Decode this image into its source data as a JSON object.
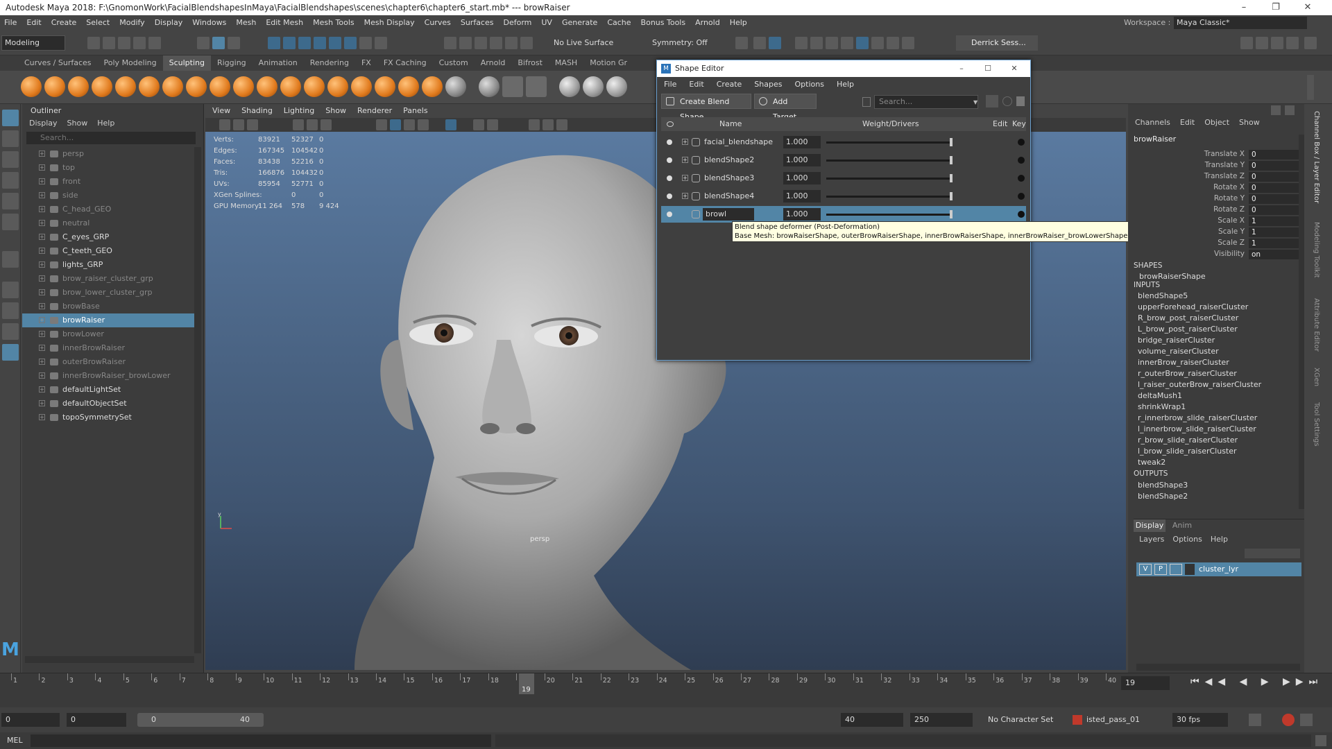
{
  "window": {
    "title": "Autodesk Maya 2018: F:\\GnomonWork\\FacialBlendshapesInMaya\\FacialBlendshapes\\scenes\\chapter6\\chapter6_start.mb*  ---  browRaiser"
  },
  "menubar": [
    "File",
    "Edit",
    "Create",
    "Select",
    "Modify",
    "Display",
    "Windows",
    "Mesh",
    "Edit Mesh",
    "Mesh Tools",
    "Mesh Display",
    "Curves",
    "Surfaces",
    "Deform",
    "UV",
    "Generate",
    "Cache",
    "Bonus Tools",
    "Arnold",
    "Help"
  ],
  "workspace": {
    "label": "Workspace :",
    "value": "Maya Classic*"
  },
  "statusline": {
    "menuset": "Modeling",
    "live_surface": "No Live Surface",
    "symmetry": "Symmetry: Off",
    "user": "Derrick Sess..."
  },
  "shelf_tabs": [
    "Curves / Surfaces",
    "Poly Modeling",
    "Sculpting",
    "Rigging",
    "Animation",
    "Rendering",
    "FX",
    "FX Caching",
    "Custom",
    "Arnold",
    "Bifrost",
    "MASH",
    "Motion Gr"
  ],
  "shelf_active": "Sculpting",
  "outliner": {
    "title": "Outliner",
    "menu": [
      "Display",
      "Show",
      "Help"
    ],
    "search_placeholder": "Search...",
    "items": [
      {
        "label": "persp"
      },
      {
        "label": "top"
      },
      {
        "label": "front"
      },
      {
        "label": "side"
      },
      {
        "label": "C_head_GEO"
      },
      {
        "label": "neutral"
      },
      {
        "label": "C_eyes_GRP"
      },
      {
        "label": "C_teeth_GEO"
      },
      {
        "label": "lights_GRP"
      },
      {
        "label": "brow_raiser_cluster_grp"
      },
      {
        "label": "brow_lower_cluster_grp"
      },
      {
        "label": "browBase"
      },
      {
        "label": "browRaiser"
      },
      {
        "label": "browLower"
      },
      {
        "label": "innerBrowRaiser"
      },
      {
        "label": "outerBrowRaiser"
      },
      {
        "label": "innerBrowRaiser_browLower"
      },
      {
        "label": "defaultLightSet"
      },
      {
        "label": "defaultObjectSet"
      },
      {
        "label": "topoSymmetrySet"
      }
    ]
  },
  "viewport": {
    "menu": [
      "View",
      "Shading",
      "Lighting",
      "Show",
      "Renderer",
      "Panels"
    ],
    "camera_label": "persp",
    "hud": [
      {
        "label": "Verts:",
        "a": "83921",
        "b": "52327",
        "c": "0"
      },
      {
        "label": "Edges:",
        "a": "167345",
        "b": "104542",
        "c": "0"
      },
      {
        "label": "Faces:",
        "a": "83438",
        "b": "52216",
        "c": "0"
      },
      {
        "label": "Tris:",
        "a": "166876",
        "b": "104432",
        "c": "0"
      },
      {
        "label": "UVs:",
        "a": "85954",
        "b": "52771",
        "c": "0"
      },
      {
        "label": "XGen Splines:",
        "a": "",
        "b": "0",
        "c": "0"
      },
      {
        "label": "GPU Memory:",
        "a": "11 264",
        "b": "578",
        "c": "9 424"
      }
    ],
    "axis_y": "y"
  },
  "shape_editor": {
    "title": "Shape Editor",
    "menu": [
      "File",
      "Edit",
      "Create",
      "Shapes",
      "Options",
      "Help"
    ],
    "create_button": "Create Blend Shape",
    "add_target_button": "Add Target",
    "search_placeholder": "Search...",
    "headers": {
      "name": "Name",
      "weight": "Weight/Drivers",
      "edit": "Edit",
      "key": "Key"
    },
    "rows": [
      {
        "name": "facial_blendshape",
        "weight": "1.000"
      },
      {
        "name": "blendShape2",
        "weight": "1.000"
      },
      {
        "name": "blendShape3",
        "weight": "1.000"
      },
      {
        "name": "blendShape4",
        "weight": "1.000"
      },
      {
        "name": "browl",
        "weight": "1.000"
      }
    ],
    "tooltip": {
      "line1": "Blend shape deformer (Post-Deformation)",
      "line2": "Base Mesh: browRaiserShape, outerBrowRaiserShape, innerBrowRaiserShape, innerBrowRaiser_browLowerShape"
    }
  },
  "channelbox": {
    "menu": [
      "Channels",
      "Edit",
      "Object",
      "Show"
    ],
    "object": "browRaiser",
    "channels": [
      {
        "name": "Translate X",
        "value": "0"
      },
      {
        "name": "Translate Y",
        "value": "0"
      },
      {
        "name": "Translate Z",
        "value": "0"
      },
      {
        "name": "Rotate X",
        "value": "0"
      },
      {
        "name": "Rotate Y",
        "value": "0"
      },
      {
        "name": "Rotate Z",
        "value": "0"
      },
      {
        "name": "Scale X",
        "value": "1"
      },
      {
        "name": "Scale Y",
        "value": "1"
      },
      {
        "name": "Scale Z",
        "value": "1"
      },
      {
        "name": "Visibility",
        "value": "on"
      }
    ],
    "shapes_header": "SHAPES",
    "shape": "browRaiserShape",
    "inputs_header": "INPUTS",
    "inputs": [
      "blendShape5",
      "upperForehead_raiserCluster",
      "R_brow_post_raiserCluster",
      "L_brow_post_raiserCluster",
      "bridge_raiserCluster",
      "volume_raiserCluster",
      "innerBrow_raiserCluster",
      "r_outerBrow_raiserCluster",
      "l_raiser_outerBrow_raiserCluster",
      "deltaMush1",
      "shrinkWrap1",
      "r_innerbrow_slide_raiserCluster",
      "l_innerbrow_slide_raiserCluster",
      "r_brow_slide_raiserCluster",
      "l_brow_slide_raiserCluster",
      "tweak2"
    ],
    "outputs_header": "OUTPUTS",
    "outputs": [
      "blendShape3",
      "blendShape2"
    ],
    "layer_tabs": [
      "Display",
      "Anim"
    ],
    "layer_menu": [
      "Layers",
      "Options",
      "Help"
    ],
    "layer": {
      "v": "V",
      "p": "P",
      "name": "cluster_lyr"
    }
  },
  "side_tabs": [
    "Channel Box / Layer Editor",
    "Modeling Toolkit",
    "Attribute Editor",
    "XGen",
    "Tool Settings"
  ],
  "timeline": {
    "ticks": [
      "1",
      "2",
      "3",
      "4",
      "5",
      "6",
      "7",
      "8",
      "9",
      "10",
      "11",
      "12",
      "13",
      "14",
      "15",
      "16",
      "17",
      "18",
      "19",
      "20",
      "21",
      "22",
      "23",
      "24",
      "25",
      "26",
      "27",
      "28",
      "29",
      "30",
      "31",
      "32",
      "33",
      "34",
      "35",
      "36",
      "37",
      "38",
      "39",
      "40"
    ],
    "current": "19",
    "current_frame_field": "19"
  },
  "range": {
    "start": "0",
    "anim_start": "0",
    "slider_start": "0",
    "slider_end": "40",
    "end": "40",
    "anim_end": "250",
    "character_set": "No Character Set",
    "anim_layer": "isted_pass_01",
    "fps": "30 fps"
  },
  "mel": {
    "label": "MEL"
  },
  "colors": {
    "accent": "#5285a6",
    "timeline_current": "#a0a0a0",
    "shelf_icon": "#e07a1d"
  }
}
